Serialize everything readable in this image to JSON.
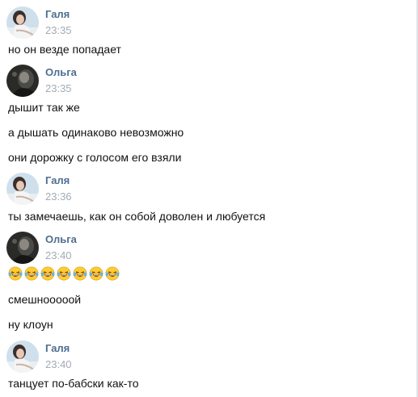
{
  "messages": [
    {
      "author": "Галя",
      "time": "23:35",
      "avatar_icon": "woman-photo-avatar",
      "lines": [
        "но он везде попадает"
      ]
    },
    {
      "author": "Ольга",
      "time": "23:35",
      "avatar_icon": "dark-photo-avatar",
      "lines": [
        "дышит так же",
        "а дышать одинаково невозможно",
        "они дорожку с голосом его взяли"
      ]
    },
    {
      "author": "Галя",
      "time": "23:36",
      "avatar_icon": "woman-photo-avatar",
      "lines": [
        "ты замечаешь, как он собой доволен и любуется"
      ]
    },
    {
      "author": "Ольга",
      "time": "23:40",
      "avatar_icon": "dark-photo-avatar",
      "emoji_row": {
        "emoji": "laughing-with-tears-emoji",
        "count": 7
      },
      "lines": [
        "смешнооооой",
        "ну клоун"
      ]
    },
    {
      "author": "Галя",
      "time": "23:40",
      "avatar_icon": "woman-photo-avatar",
      "lines": [
        "танцует по-бабски как-то"
      ]
    }
  ],
  "colors": {
    "author_name": "#4e6e91",
    "timestamp": "#a3abb3",
    "message_text": "#111111",
    "background": "#ffffff",
    "emoji_face": "#ffcc33"
  }
}
